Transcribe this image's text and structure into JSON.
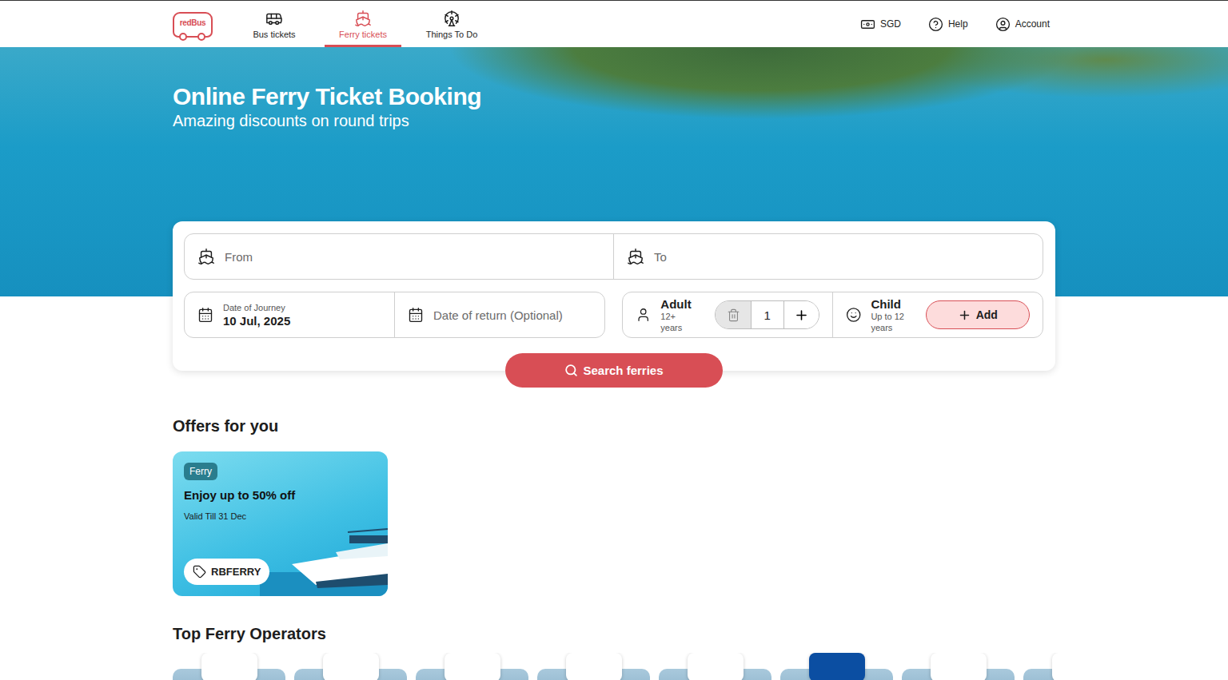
{
  "header": {
    "logo": "redBus",
    "nav": [
      {
        "label": "Bus tickets",
        "selected": false,
        "kind": "bus"
      },
      {
        "label": "Ferry tickets",
        "selected": true,
        "kind": "ferry"
      },
      {
        "label": "Things To Do",
        "selected": false,
        "kind": "things"
      }
    ],
    "actions": [
      {
        "label": "SGD",
        "kind": "currency"
      },
      {
        "label": "Help",
        "kind": "help"
      },
      {
        "label": "Account",
        "kind": "account"
      }
    ]
  },
  "hero": {
    "title": "Online Ferry Ticket Booking",
    "subtitle": "Amazing discounts on round trips"
  },
  "search": {
    "from": {
      "placeholder": "From"
    },
    "to": {
      "placeholder": "To"
    },
    "date_of_journey": {
      "label": "Date of Journey",
      "value": "10 Jul, 2025"
    },
    "date_of_return": {
      "placeholder": "Date of return (Optional)"
    },
    "passengers": [
      {
        "label": "Adult",
        "age": "12+ years",
        "count": "1",
        "kind": "stepper"
      },
      {
        "label": "Child",
        "age": "Up to 12 years",
        "button": "Add",
        "kind": "add"
      }
    ],
    "button": "Search ferries"
  },
  "offers": {
    "title": "Offers for you",
    "items": [
      {
        "tag": "Ferry",
        "title": "Enjoy up to 50% off",
        "validity": "Valid Till 31 Dec",
        "code": "RBFERRY"
      }
    ]
  },
  "operators": {
    "title": "Top Ferry Operators",
    "items": [
      {
        "color": "#ffffff"
      },
      {
        "color": "#ffffff"
      },
      {
        "color": "#ffffff"
      },
      {
        "color": "#ffffff"
      },
      {
        "color": "#ffffff"
      },
      {
        "color": "#0b4ea2"
      },
      {
        "color": "#ffffff"
      },
      {
        "color": "#ffffff"
      }
    ]
  }
}
